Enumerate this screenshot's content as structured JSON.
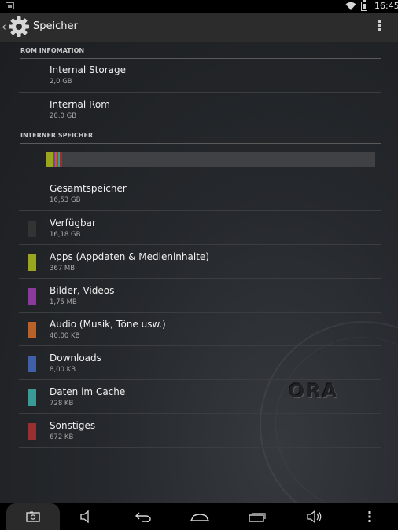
{
  "status": {
    "time": "16:45"
  },
  "action_bar": {
    "title": "Speicher"
  },
  "sections": {
    "rom": "ROM INFOMATION",
    "internal": "INTERNER SPEICHER"
  },
  "rom_items": [
    {
      "label": "Internal Storage",
      "value": "2,0 GB"
    },
    {
      "label": "Internal Rom",
      "value": "20.0 GB"
    }
  ],
  "storage_items": [
    {
      "label": "Gesamtspeicher",
      "value": "16,53 GB"
    },
    {
      "label": "Verfügbar",
      "value": "16,18 GB",
      "color": "#333333"
    },
    {
      "label": "Apps (Appdaten & Medieninhalte)",
      "value": "367 MB",
      "color": "#9aa51e"
    },
    {
      "label": "Bilder, Videos",
      "value": "1,75 MB",
      "color": "#8a3a9a"
    },
    {
      "label": "Audio (Musik, Töne usw.)",
      "value": "40,00 KB",
      "color": "#b8622a"
    },
    {
      "label": "Downloads",
      "value": "8,00 KB",
      "color": "#3f5fa8"
    },
    {
      "label": "Daten im Cache",
      "value": "728 KB",
      "color": "#3a9a96"
    },
    {
      "label": "Sonstiges",
      "value": "672 KB",
      "color": "#9a2f2f"
    }
  ],
  "usage_bar": {
    "track_color": "#3f4144",
    "segments": [
      {
        "name": "apps",
        "color": "#9aa51e",
        "fraction": 0.021
      },
      {
        "name": "images",
        "color": "#8a3a9a",
        "fraction": 0.006
      },
      {
        "name": "audio",
        "color": "#b8622a",
        "fraction": 0.004
      },
      {
        "name": "downloads",
        "color": "#3f5fa8",
        "fraction": 0.004
      },
      {
        "name": "cache",
        "color": "#3a9a96",
        "fraction": 0.005
      },
      {
        "name": "misc",
        "color": "#9a2f2f",
        "fraction": 0.007
      }
    ]
  },
  "watermark": "ORA",
  "icons": {
    "gear": "settings-gear-icon",
    "overflow": "overflow-menu-icon",
    "nav": [
      "screenshot-icon",
      "volume-down-icon",
      "back-icon",
      "home-icon",
      "recent-apps-icon",
      "volume-up-icon",
      "menu-icon"
    ]
  }
}
